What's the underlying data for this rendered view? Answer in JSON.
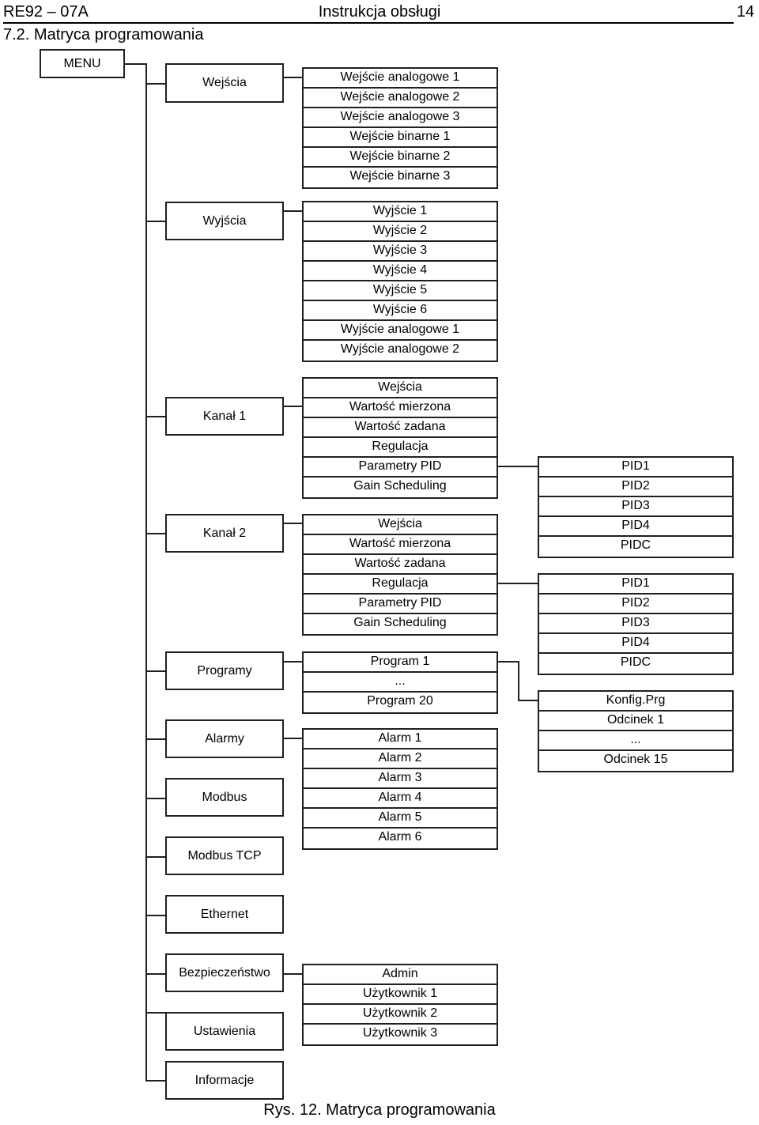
{
  "header": {
    "left": "RE92 – 07A",
    "center": "Instrukcja obsługi",
    "page_number": "14"
  },
  "section": {
    "title": "7.2. Matryca programowania"
  },
  "caption": "Rys. 12. Matryca programowania",
  "root": {
    "label": "MENU"
  },
  "level1": {
    "wejscia": "Wejścia",
    "wyjscia": "Wyjścia",
    "kanal1": "Kanał 1",
    "kanal2": "Kanał 2",
    "programy": "Programy",
    "alarmy": "Alarmy",
    "modbus": "Modbus",
    "modbus_tcp": "Modbus TCP",
    "ethernet": "Ethernet",
    "bezpieczenstwo": "Bezpieczeństwo",
    "ustawienia": "Ustawienia",
    "informacje": "Informacje"
  },
  "level2": {
    "wejscia_items": [
      "Wejście analogowe 1",
      "Wejście analogowe 2",
      "Wejście analogowe 3",
      "Wejście binarne 1",
      "Wejście binarne 2",
      "Wejście binarne 3"
    ],
    "wyjscia_items": [
      "Wyjście 1",
      "Wyjście 2",
      "Wyjście 3",
      "Wyjście 4",
      "Wyjście 5",
      "Wyjście 6",
      "Wyjście analogowe 1",
      "Wyjście analogowe 2"
    ],
    "kanal1_items": [
      "Wejścia",
      "Wartość mierzona",
      "Wartość zadana",
      "Regulacja",
      "Parametry PID",
      "Gain Scheduling"
    ],
    "kanal2_items": [
      "Wejścia",
      "Wartość mierzona",
      "Wartość zadana",
      "Regulacja",
      "Parametry PID",
      "Gain Scheduling"
    ],
    "programy_items": [
      "Program 1",
      "...",
      "Program 20"
    ],
    "alarmy_items": [
      "Alarm 1",
      "Alarm 2",
      "Alarm 3",
      "Alarm 4",
      "Alarm 5",
      "Alarm 6"
    ],
    "bezpieczenstwo_items": [
      "Admin",
      "Użytkownik 1",
      "Użytkownik 2",
      "Użytkownik 3"
    ]
  },
  "level3": {
    "pid_kanal1_items": [
      "PID1",
      "PID2",
      "PID3",
      "PID4",
      "PIDC"
    ],
    "pid_kanal2_items": [
      "PID1",
      "PID2",
      "PID3",
      "PID4",
      "PIDC"
    ],
    "konfig_prg_items": [
      "Konfig.Prg",
      "Odcinek 1",
      "...",
      "Odcinek 15"
    ]
  }
}
